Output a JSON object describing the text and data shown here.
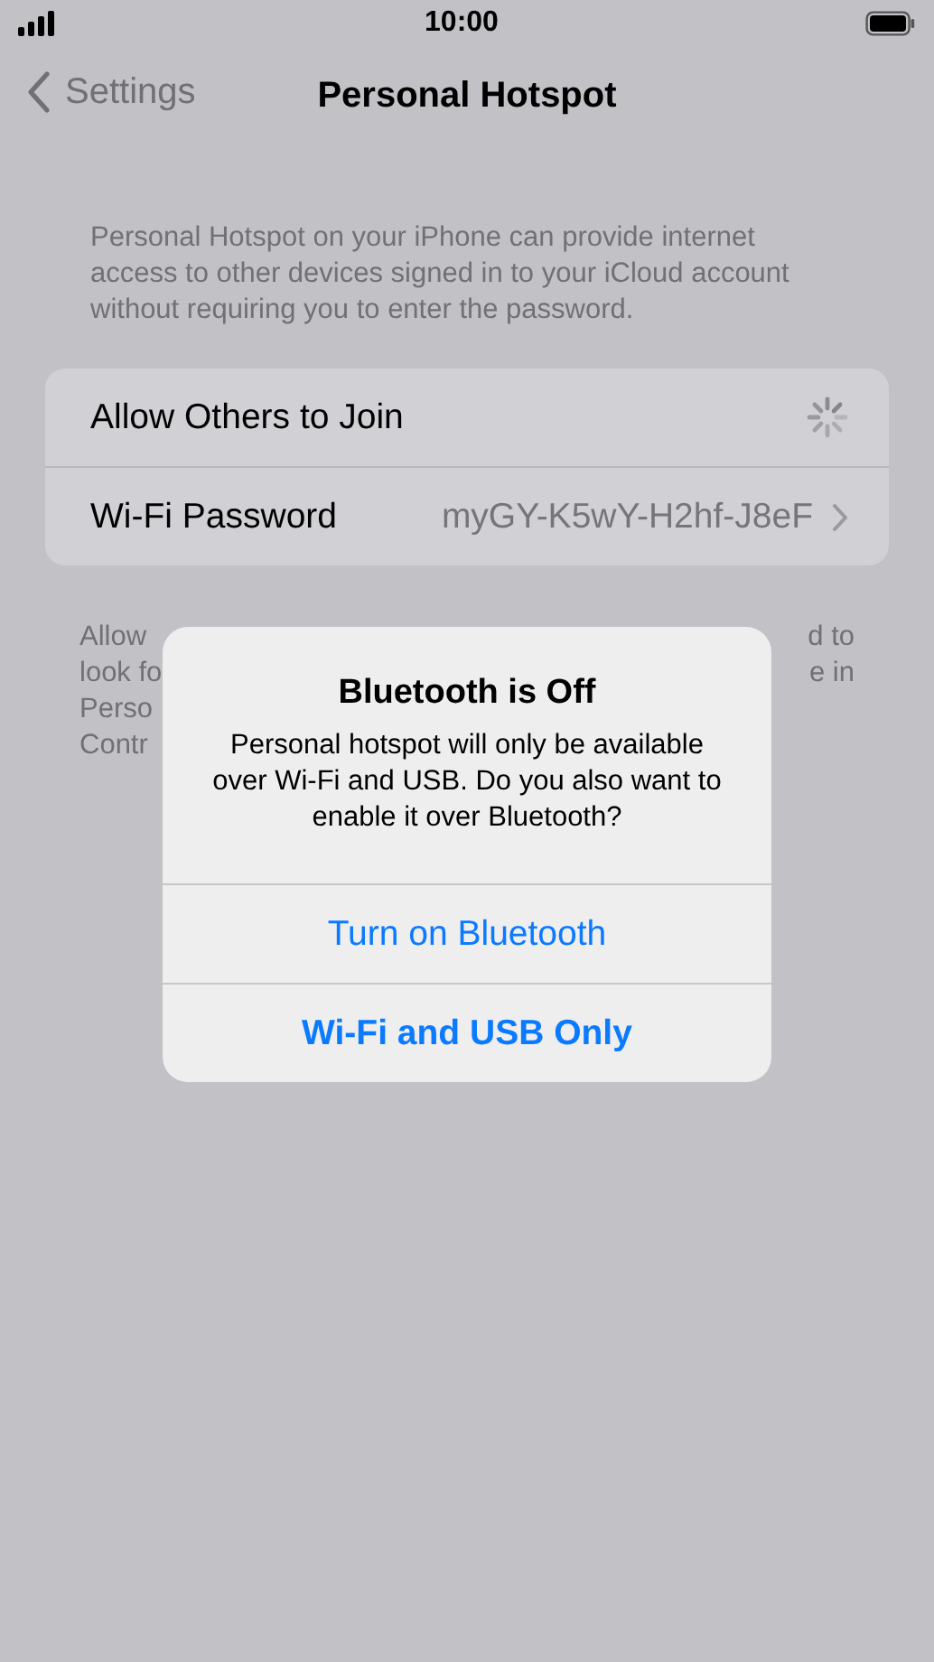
{
  "status_bar": {
    "time": "10:00"
  },
  "nav": {
    "back_label": "Settings",
    "title": "Personal Hotspot"
  },
  "description": "Personal Hotspot on your iPhone can provide internet access to other devices signed in to your iCloud account without requiring you to enter the password.",
  "settings": [
    {
      "kind": "spinner",
      "label": "Allow Others to Join"
    },
    {
      "kind": "link",
      "label": "Wi-Fi Password",
      "value": "myGY-K5wY-H2hf-J8eF"
    }
  ],
  "footer_fragments": [
    {
      "left": "Allow",
      "right": "d to"
    },
    {
      "left": "look fo",
      "right": "e in"
    },
    {
      "left": "Perso"
    },
    {
      "left": "Contr"
    }
  ],
  "alert": {
    "title": "Bluetooth is Off",
    "message": "Personal hotspot will only be available over Wi-Fi and USB. Do you also want to enable it over Bluetooth?",
    "buttons": [
      {
        "label": "Turn on Bluetooth",
        "preferred": false
      },
      {
        "label": "Wi-Fi and USB Only",
        "preferred": true
      }
    ]
  }
}
